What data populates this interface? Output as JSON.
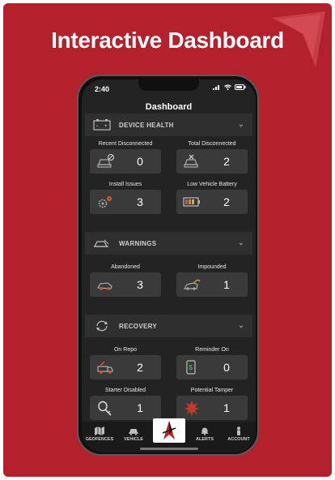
{
  "banner": {
    "title": "Interactive Dashboard"
  },
  "status_bar": {
    "time": "2:40"
  },
  "nav": {
    "title": "Dashboard"
  },
  "sections": [
    {
      "title": "DEVICE HEALTH",
      "icon": "battery-outline-icon",
      "tiles": [
        {
          "label": "Recent Disconnected",
          "value": "0",
          "icon": "car-disconnected-icon"
        },
        {
          "label": "Total Disconnected",
          "value": "2",
          "icon": "car-disconnected-icon"
        },
        {
          "label": "Install Issues",
          "value": "3",
          "icon": "gears-icon"
        },
        {
          "label": "Low Vehicle Battery",
          "value": "2",
          "icon": "low-battery-icon"
        }
      ]
    },
    {
      "title": "WARNINGS",
      "icon": "car-warning-icon",
      "tiles": [
        {
          "label": "Abandoned",
          "value": "3",
          "icon": "abandoned-car-icon"
        },
        {
          "label": "Impounded",
          "value": "1",
          "icon": "impounded-car-icon"
        }
      ]
    },
    {
      "title": "RECOVERY",
      "icon": "recovery-icon",
      "tiles": [
        {
          "label": "On Repo",
          "value": "2",
          "icon": "tow-truck-icon"
        },
        {
          "label": "Reminder On",
          "value": "0",
          "icon": "payment-reminder-icon"
        },
        {
          "label": "Starter Disabled",
          "value": "1",
          "icon": "key-icon"
        },
        {
          "label": "Potential Tamper",
          "value": "1",
          "icon": "tamper-icon"
        }
      ]
    }
  ],
  "tabs": [
    {
      "label": "GEOFENCES",
      "icon": "map-icon"
    },
    {
      "label": "VEHICLE",
      "icon": "car-icon"
    },
    {
      "label": "",
      "icon": "brand-logo-icon"
    },
    {
      "label": "ALERTS",
      "icon": "bell-icon"
    },
    {
      "label": "ACCOUNT",
      "icon": "person-icon"
    }
  ],
  "colors": {
    "brand_red": "#b3222c",
    "screen_bg": "#232323",
    "tile_bg": "#3a3a3a",
    "accent_orange": "#e0552a"
  }
}
